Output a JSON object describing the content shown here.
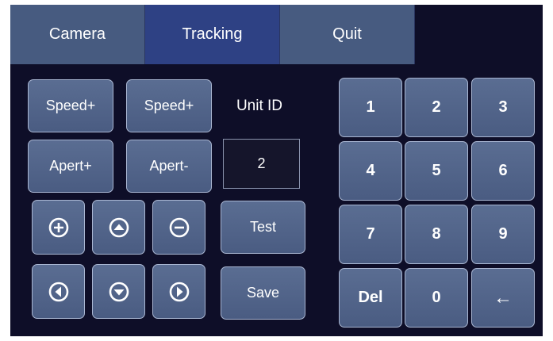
{
  "tabs": [
    {
      "label": "Camera"
    },
    {
      "label": "Tracking"
    },
    {
      "label": "Quit"
    }
  ],
  "controls": {
    "speed_plus_1": "Speed+",
    "speed_plus_2": "Speed+",
    "apert_plus": "Apert+",
    "apert_minus": "Apert-",
    "unit_id_label": "Unit ID",
    "unit_id_value": "2",
    "test": "Test",
    "save": "Save"
  },
  "direction_icons": [
    "zoom-in-icon",
    "arrow-up-icon",
    "zoom-out-icon",
    "arrow-left-icon",
    "arrow-down-icon",
    "arrow-right-icon"
  ],
  "keypad": [
    "1",
    "2",
    "3",
    "4",
    "5",
    "6",
    "7",
    "8",
    "9",
    "Del",
    "0",
    "←"
  ],
  "colors": {
    "background": "#0e0e28",
    "tab": "#475b80",
    "tab_active": "#2e4184",
    "button": "#55688d",
    "button_border": "#a9b6d2"
  }
}
